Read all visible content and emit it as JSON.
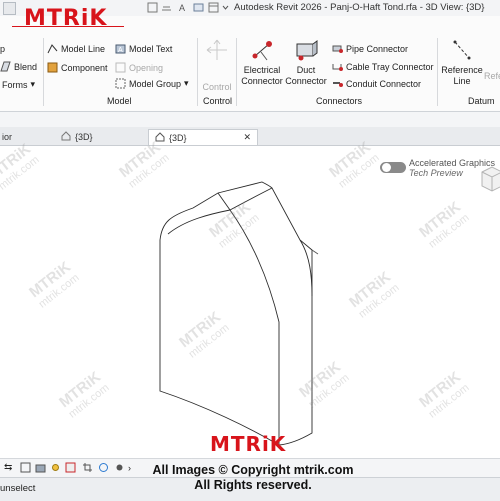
{
  "window": {
    "title": "Autodesk Revit 2026 - Panj-O-Haft Tond.rfa - 3D View: {3D}",
    "brand_logo": "MTRiK"
  },
  "ribbon": {
    "left_items": {
      "p": "p",
      "blend": "Blend",
      "forms": "Forms"
    },
    "model": {
      "model_line": "Model Line",
      "model_text": "Model Text",
      "component": "Component",
      "opening": "Opening",
      "model_group": "Model Group",
      "panel_label": "Model"
    },
    "control": {
      "control_btn": "Control",
      "panel_label": "Control"
    },
    "connectors": {
      "electrical_connector": [
        "Electrical",
        "Connector"
      ],
      "duct_connector": [
        "Duct",
        "Connector"
      ],
      "pipe_connector": "Pipe  Connector",
      "cable_tray_connector": "Cable Tray  Connector",
      "conduit_connector": "Conduit  Connector",
      "panel_label": "Connectors"
    },
    "datum": {
      "reference_line": [
        "Reference",
        "Line"
      ],
      "reference_plane_partial": "Refe",
      "panel_label": "Datum"
    }
  },
  "tabs": [
    {
      "label": "ior",
      "active": false
    },
    {
      "label": "{3D}",
      "active": false
    },
    {
      "label": "{3D}",
      "active": true
    }
  ],
  "viewport": {
    "accelerated_graphics": "Accelerated Graphics",
    "tech_preview": "Tech Preview"
  },
  "watermark": {
    "site": "mtrik.com",
    "logo": "MTRiK",
    "copyright_line1": "All Images © Copyright mtrik.com",
    "copyright_line2": "All Rights reserved."
  },
  "status": {
    "text": "unselect"
  },
  "colors": {
    "brand_red": "#d8141b",
    "accent_red": "#c8262b",
    "toggle_gray": "#8a8a8a"
  }
}
